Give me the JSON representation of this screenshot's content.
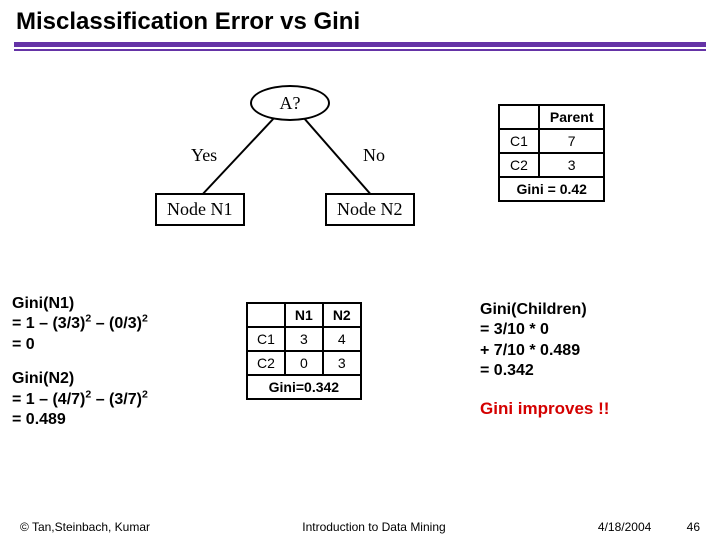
{
  "title": "Misclassification Error vs Gini",
  "tree": {
    "question": "A?",
    "yes": "Yes",
    "no": "No",
    "node1": "Node N1",
    "node2": "Node N2"
  },
  "parent_table": {
    "header": "Parent",
    "rows": [
      {
        "label": "C1",
        "value": "7"
      },
      {
        "label": "C2",
        "value": "3"
      }
    ],
    "footer_label": "Gini = 0.42"
  },
  "gini_n1": {
    "line1": "Gini(N1)",
    "line2_pre": "= 1 – (3/3)",
    "line2_mid": " – (0/3)",
    "line3": "= 0"
  },
  "gini_n2": {
    "line1": "Gini(N2)",
    "line2_pre": "= 1 – (4/7)",
    "line2_mid": " – (3/7)",
    "line3": "= 0.489"
  },
  "child_table": {
    "col1": "N1",
    "col2": "N2",
    "rows": [
      {
        "label": "C1",
        "v1": "3",
        "v2": "4"
      },
      {
        "label": "C2",
        "v1": "0",
        "v2": "3"
      }
    ],
    "footer_label": "Gini=0.342"
  },
  "gini_children": {
    "line1": "Gini(Children)",
    "line2": "= 3/10 * 0",
    "line3": "+ 7/10 * 0.489",
    "line4": "= 0.342"
  },
  "improves": "Gini improves !!",
  "footer": {
    "left": "© Tan,Steinbach, Kumar",
    "center": "Introduction to Data Mining",
    "date": "4/18/2004",
    "page": "46"
  },
  "chart_data": {
    "type": "table",
    "title": "Misclassification Error vs Gini",
    "parent": {
      "C1": 7,
      "C2": 3,
      "gini": 0.42
    },
    "split_attribute": "A",
    "nodes": {
      "N1": {
        "branch": "Yes",
        "C1": 3,
        "C2": 0,
        "gini": 0
      },
      "N2": {
        "branch": "No",
        "C1": 4,
        "C2": 3,
        "gini": 0.489
      }
    },
    "weighted_gini_children": 0.342,
    "weights": {
      "N1": 0.3,
      "N2": 0.7
    }
  }
}
